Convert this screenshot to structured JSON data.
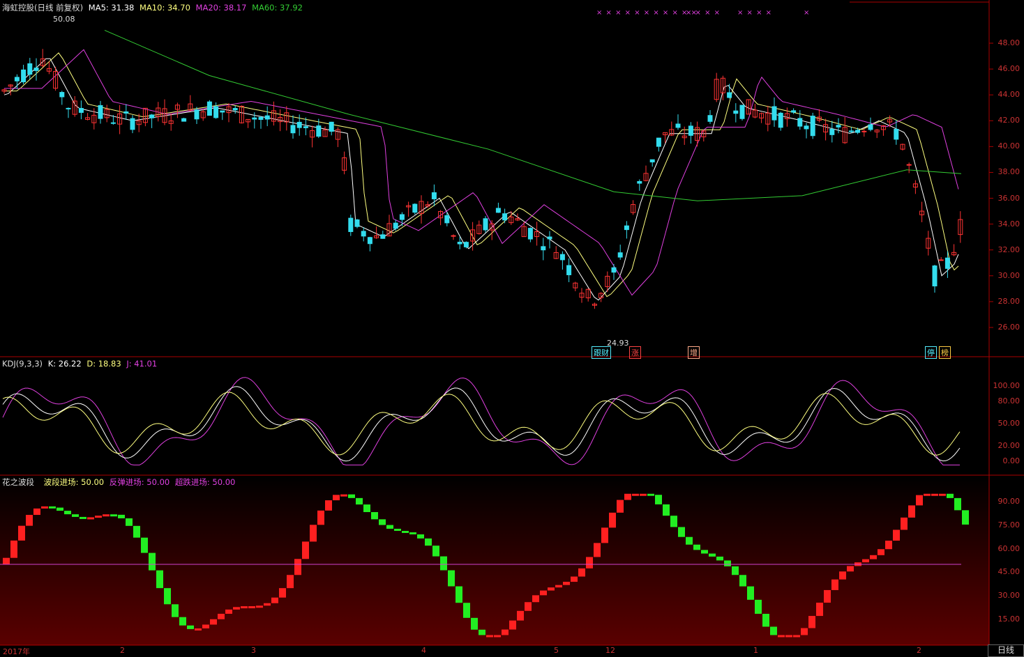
{
  "price_panel": {
    "title": "海虹控股(日线 前复权)",
    "ma5": "MA5: 31.38",
    "ma10": "MA10: 34.70",
    "ma20": "MA20: 38.17",
    "ma60": "MA60: 37.92",
    "high_marker": "50.08",
    "low_marker": "24.93",
    "y_ticks": [
      "48.00",
      "46.00",
      "44.00",
      "42.00",
      "40.00",
      "38.00",
      "36.00",
      "34.00",
      "32.00",
      "30.00",
      "28.00",
      "26.00"
    ],
    "events": [
      {
        "label": "跟财",
        "color": "#5ef"
      },
      {
        "label": "涨",
        "color": "#f44"
      },
      {
        "label": "增",
        "color": "#fa8"
      },
      {
        "label": "停",
        "color": "#5ef"
      },
      {
        "label": "榜",
        "color": "#fc4"
      }
    ],
    "x_markers_group1": "× × × × × × × × × × ×",
    "x_markers_group2": "× × × ×",
    "x_markers_group3": "× × × ×",
    "x_markers_group4": "×"
  },
  "kdj_panel": {
    "title": "KDJ(9,3,3)",
    "k": "K: 26.22",
    "d": "D: 18.83",
    "j": "J: 41.01",
    "y_ticks": [
      "100.00",
      "80.00",
      "50.00",
      "20.00",
      "0.00"
    ]
  },
  "wave_panel": {
    "title": "花之波段",
    "entry1": "波段进场: 50.00",
    "entry2": "反弹进场: 50.00",
    "entry3": "超跌进场: 50.00",
    "y_ticks": [
      "90.00",
      "75.00",
      "60.00",
      "45.00",
      "30.00",
      "15.00"
    ]
  },
  "date_axis": {
    "ticks": [
      "2017年",
      "2",
      "3",
      "4",
      "5",
      "12",
      "1",
      "2"
    ]
  },
  "tab_daily": "日线",
  "colors": {
    "up": "#ff3333",
    "down": "#33ddee",
    "ma5": "#ffffff",
    "ma10": "#ffff80",
    "ma20": "#e040e0",
    "ma60": "#33cc33",
    "wave_up": "#ff2020",
    "wave_down": "#22ee22"
  },
  "chart_data": [
    {
      "type": "line",
      "title": "海虹控股(日线 前复权)",
      "ylim": [
        25,
        48
      ],
      "series": [
        {
          "name": "MA5",
          "values": [
            31.38
          ]
        },
        {
          "name": "MA10",
          "values": [
            34.7
          ]
        },
        {
          "name": "MA20",
          "values": [
            38.17
          ]
        },
        {
          "name": "MA60",
          "values": [
            37.92
          ]
        }
      ],
      "annotations": [
        "50.08",
        "24.93"
      ]
    },
    {
      "type": "line",
      "title": "KDJ(9,3,3)",
      "ylim": [
        0,
        100
      ],
      "series": [
        {
          "name": "K",
          "values": [
            26.22
          ]
        },
        {
          "name": "D",
          "values": [
            18.83
          ]
        },
        {
          "name": "J",
          "values": [
            41.01
          ]
        }
      ]
    },
    {
      "type": "bar",
      "title": "花之波段",
      "ylim": [
        0,
        100
      ],
      "series": [
        {
          "name": "波段进场",
          "values": [
            50.0
          ]
        },
        {
          "name": "反弹进场",
          "values": [
            50.0
          ]
        },
        {
          "name": "超跌进场",
          "values": [
            50.0
          ]
        }
      ]
    }
  ]
}
